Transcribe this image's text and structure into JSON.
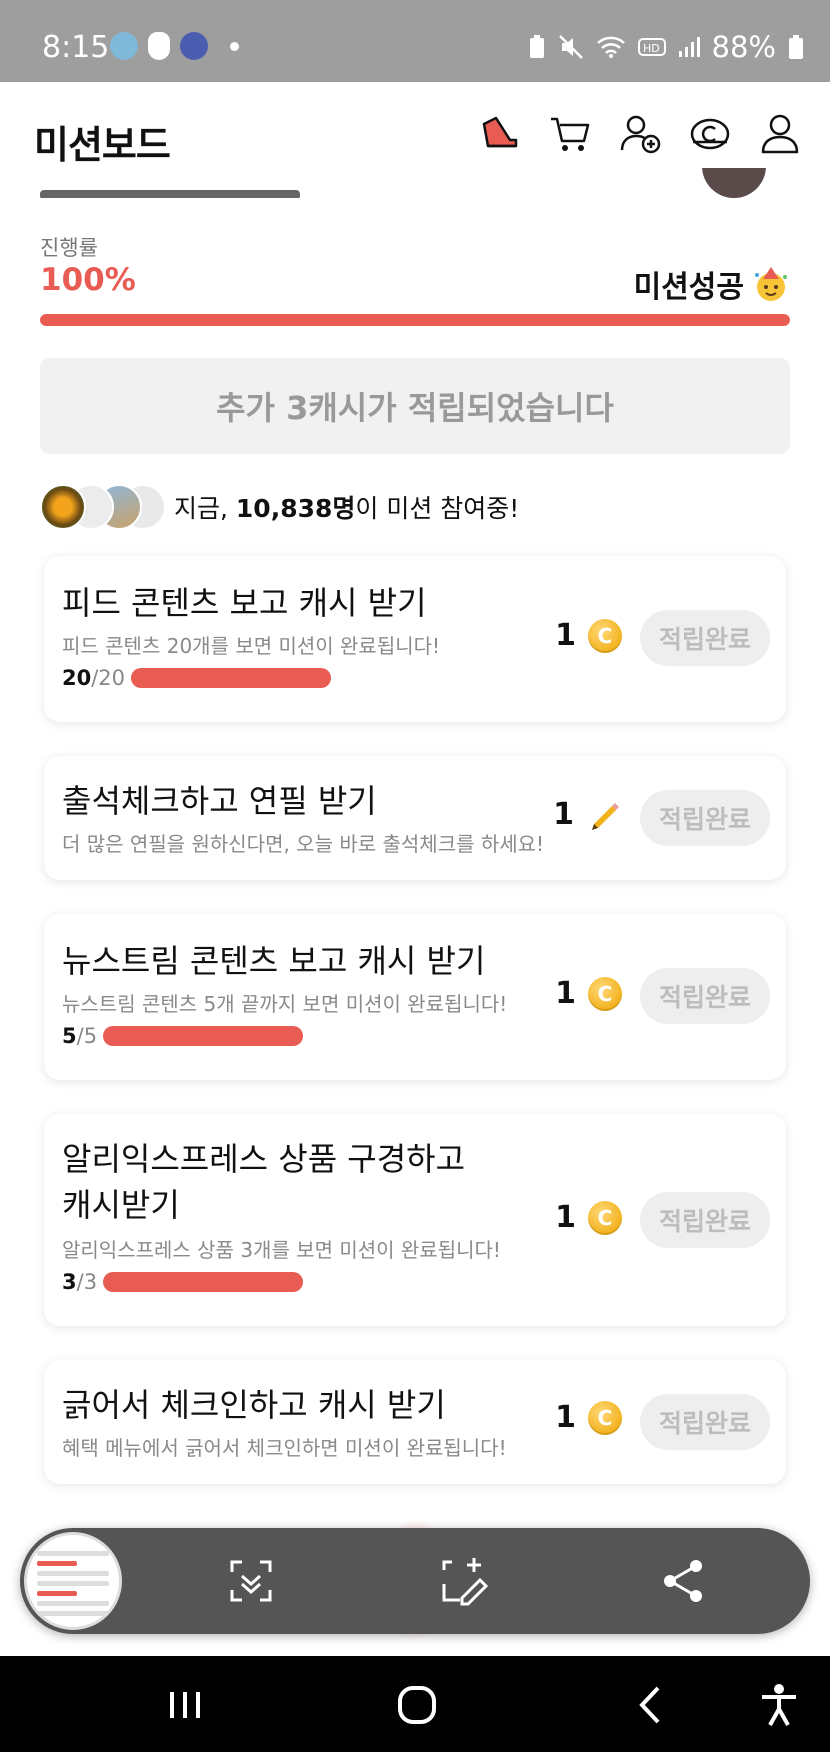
{
  "status_bar": {
    "time": "8:15",
    "battery": "88%"
  },
  "header": {
    "title": "미션보드"
  },
  "progress": {
    "label": "진행률",
    "value": "100%",
    "fraction": 1.0,
    "status": "미션성공"
  },
  "banner": {
    "text": "추가 3캐시가 적립되었습니다"
  },
  "participants": {
    "prefix": "지금, ",
    "count": "10,838명",
    "suffix": "이 미션 참여중!"
  },
  "missions": [
    {
      "title": "피드 콘텐츠 보고 캐시 받기",
      "desc": "피드 콘텐츠 20개를 보면 미션이 완료됩니다!",
      "count_done": "20",
      "count_total": "/20",
      "fraction": 1.0,
      "reward": "1",
      "reward_icon": "coin-icon",
      "button": "적립완료"
    },
    {
      "title": "출석체크하고 연필 받기",
      "desc": "더 많은 연필을 원하신다면, 오늘 바로 출석체크를 하세요!",
      "reward": "1",
      "reward_icon": "pencil-icon",
      "button": "적립완료"
    },
    {
      "title": "뉴스트림 콘텐츠 보고 캐시 받기",
      "desc": "뉴스트림 콘텐츠 5개 끝까지 보면 미션이 완료됩니다!",
      "count_done": "5",
      "count_total": "/5",
      "fraction": 1.0,
      "reward": "1",
      "reward_icon": "coin-icon",
      "button": "적립완료"
    },
    {
      "title": "알리익스프레스 상품 구경하고\n캐시받기",
      "title_line1": "알리익스프레스 상품 구경하고",
      "title_line2": "캐시받기",
      "desc": "알리익스프레스 상품 3개를 보면 미션이 완료됩니다!",
      "count_done": "3",
      "count_total": "/3",
      "fraction": 1.0,
      "reward": "1",
      "reward_icon": "coin-icon",
      "button": "적립완료"
    },
    {
      "title": "긁어서 체크인하고 캐시 받기",
      "desc": "혜택 메뉴에서 긁어서 체크인하면 미션이 완료됩니다!",
      "reward": "1",
      "reward_icon": "coin-icon",
      "button": "적립완료"
    }
  ],
  "colors": {
    "accent": "#e85c53",
    "coin": "#f2b21c",
    "muted": "#999999"
  }
}
